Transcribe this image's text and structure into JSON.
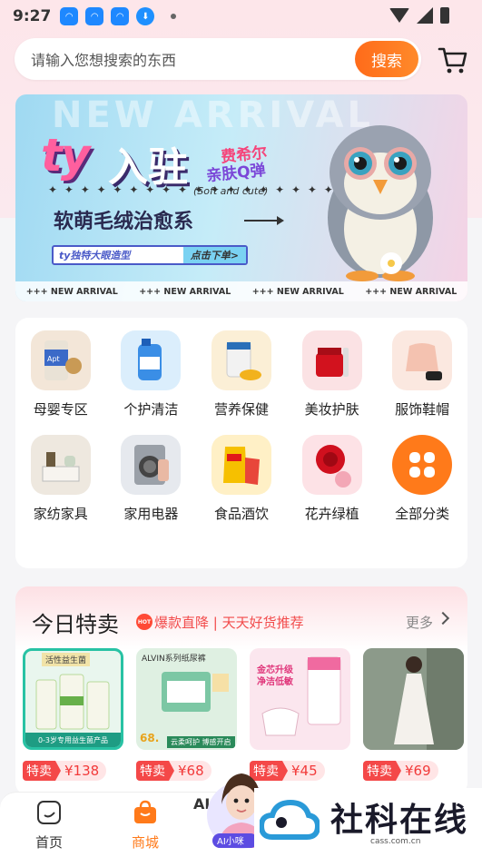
{
  "status_bar": {
    "time": "9:27",
    "app_icons": [
      "lipstick-app-icon",
      "lipstick-app-icon",
      "lipstick-app-icon",
      "download-icon"
    ]
  },
  "search": {
    "placeholder": "请输入您想搜索的东西",
    "button_label": "搜索"
  },
  "banner": {
    "watermark": "NEW ARRIVAL",
    "brand": "ty",
    "title": "入驻",
    "tag1": "费希尔",
    "tag2": "亲肤Q弹",
    "soft_text": "(Soft and cute)",
    "headline": "软萌毛绒治愈系",
    "pill_left": "ty独特大眼造型",
    "pill_right": "点击下单>",
    "ticker": [
      "NEW ARRIVAL",
      "NEW ARRIVAL",
      "NEW ARRIVAL",
      "NEW ARRIVAL"
    ],
    "ticker_prefix": "+++"
  },
  "categories": [
    {
      "label": "母婴专区",
      "icon": "infant-formula-icon",
      "color": "#f3e6d8"
    },
    {
      "label": "个护清洁",
      "icon": "detergent-icon",
      "color": "#dbeefc"
    },
    {
      "label": "营养保健",
      "icon": "supplement-icon",
      "color": "#fbefd6"
    },
    {
      "label": "美妆护肤",
      "icon": "skincare-icon",
      "color": "#fbe2e4"
    },
    {
      "label": "服饰鞋帽",
      "icon": "clothing-icon",
      "color": "#fbe8e0"
    },
    {
      "label": "家纺家具",
      "icon": "furniture-icon",
      "color": "#eee8df"
    },
    {
      "label": "家用电器",
      "icon": "washing-machine-icon",
      "color": "#e6e9ee"
    },
    {
      "label": "食品酒饮",
      "icon": "snacks-icon",
      "color": "#fff0c6"
    },
    {
      "label": "花卉绿植",
      "icon": "rose-icon",
      "color": "#fde2e6"
    },
    {
      "label": "全部分类",
      "icon": "all-categories-icon",
      "color": "#ff7a1a"
    }
  ],
  "deals": {
    "title": "今日特卖",
    "hot_badge": "HOT",
    "subtitle": "爆款直降 | 天天好货推荐",
    "more_label": "更多",
    "tag_label": "特卖",
    "items": [
      {
        "price": "¥138",
        "name": "infant-formula-product",
        "banner": "活性益生菌",
        "caption": "0-3岁专用益生菌产品"
      },
      {
        "price": "¥68",
        "name": "diaper-product",
        "banner": "ALVIN系列纸尿裤",
        "caption": "云柔呵护 博感开启",
        "badge": "68."
      },
      {
        "price": "¥45",
        "name": "baby-pants-product",
        "banner": "金芯升级 净洁低敏"
      },
      {
        "price": "¥69",
        "name": "white-dress-product"
      }
    ]
  },
  "ai_assistant": {
    "label": "AI小咪",
    "partial_text": "AI"
  },
  "bottom_nav": [
    {
      "label": "首页",
      "icon": "home-icon",
      "active": false
    },
    {
      "label": "商城",
      "icon": "shop-bag-icon",
      "active": true
    }
  ],
  "watermark": {
    "text": "社科在线",
    "domain": "cass.com.cn"
  }
}
